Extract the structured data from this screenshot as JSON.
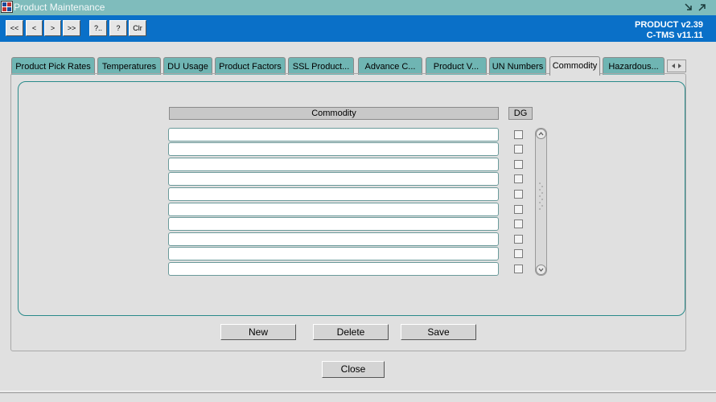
{
  "window": {
    "title": "Product Maintenance"
  },
  "toolbar": {
    "buttons": [
      {
        "label": "<<"
      },
      {
        "label": "<"
      },
      {
        "label": ">"
      },
      {
        "label": ">>"
      },
      {
        "label": "?.."
      },
      {
        "label": "?"
      },
      {
        "label": "Clr"
      }
    ],
    "version_line1": "PRODUCT v2.39",
    "version_line2": "C-TMS v11.11"
  },
  "tabs": [
    {
      "label": "Product Pick Rates"
    },
    {
      "label": "Temperatures"
    },
    {
      "label": "DU Usage"
    },
    {
      "label": "Product Factors"
    },
    {
      "label": "SSL Product..."
    },
    {
      "label": "Advance C..."
    },
    {
      "label": "Product V..."
    },
    {
      "label": "UN Numbers"
    },
    {
      "label": "Commodity"
    },
    {
      "label": "Hazardous..."
    }
  ],
  "active_tab": "Commodity",
  "grid": {
    "headers": {
      "commodity": "Commodity",
      "dg": "DG"
    },
    "rows": [
      {
        "commodity": "",
        "dg": false
      },
      {
        "commodity": "",
        "dg": false
      },
      {
        "commodity": "",
        "dg": false
      },
      {
        "commodity": "",
        "dg": false
      },
      {
        "commodity": "",
        "dg": false
      },
      {
        "commodity": "",
        "dg": false
      },
      {
        "commodity": "",
        "dg": false
      },
      {
        "commodity": "",
        "dg": false
      },
      {
        "commodity": "",
        "dg": false
      },
      {
        "commodity": "",
        "dg": false
      }
    ]
  },
  "actions": {
    "new_label": "New",
    "delete_label": "Delete",
    "save_label": "Save"
  },
  "close_label": "Close",
  "colors": {
    "titlebar": "#7fbcbc",
    "toolbar": "#0a70c8",
    "tab": "#6fb5b3",
    "panel_border": "#2a8a8a",
    "background": "#e0e0e0"
  }
}
